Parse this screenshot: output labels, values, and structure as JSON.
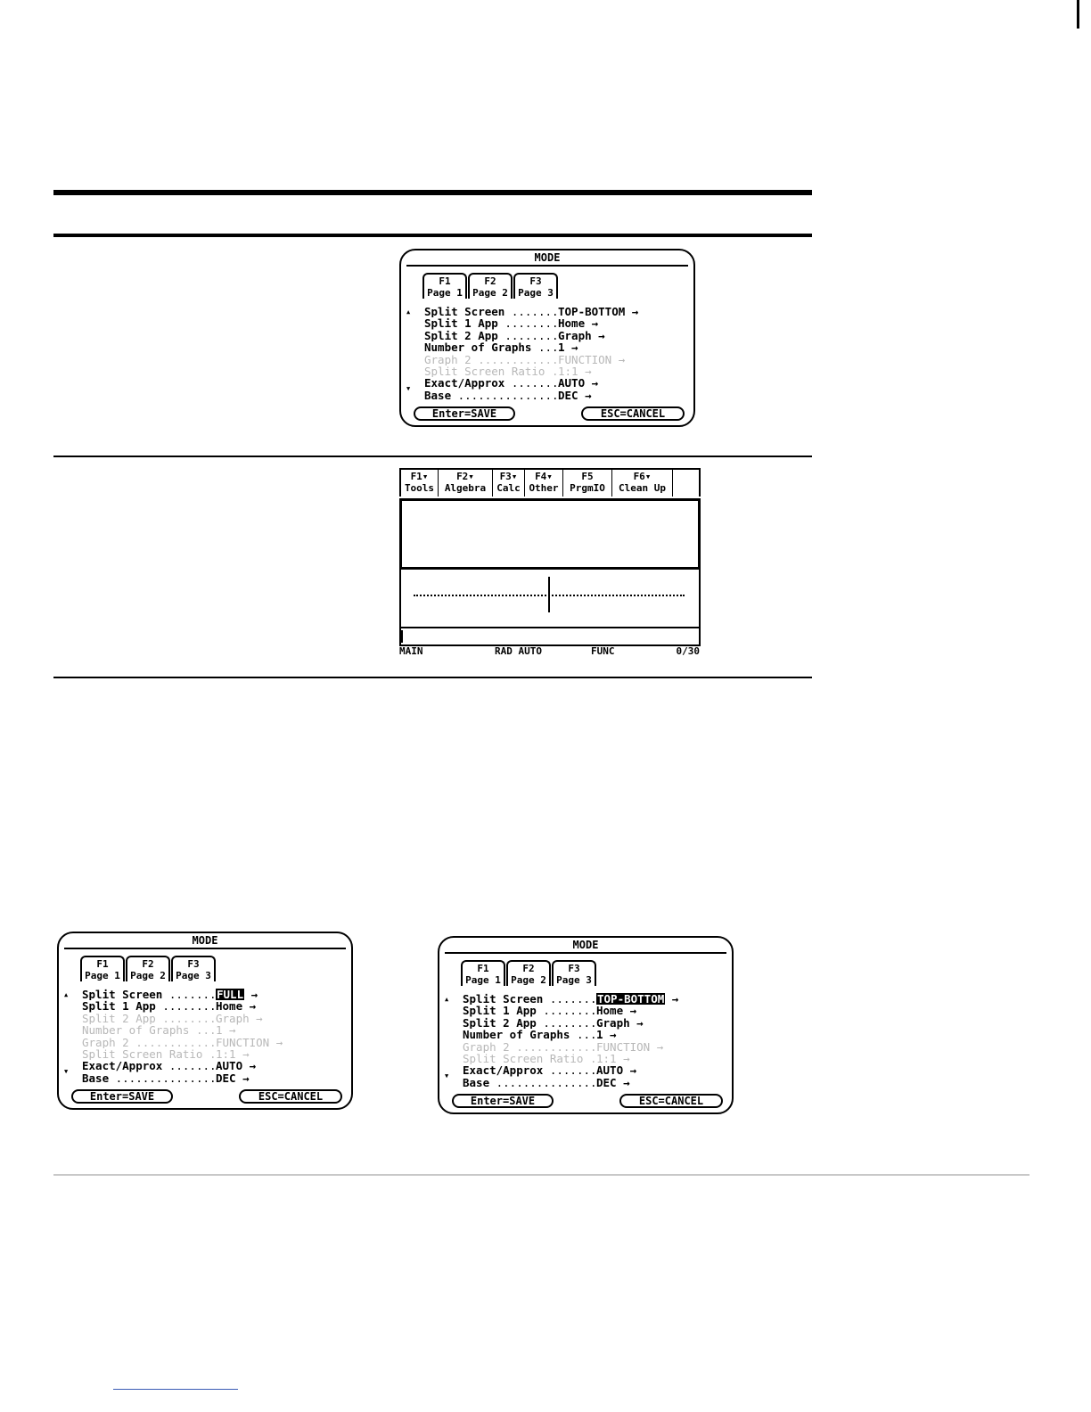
{
  "dialog_top": {
    "title": "MODE",
    "tabs": [
      {
        "key": "F1",
        "label": "Page 1"
      },
      {
        "key": "F2",
        "label": "Page 2"
      },
      {
        "key": "F3",
        "label": "Page 3"
      }
    ],
    "rows": [
      {
        "label": "Split Screen",
        "value": "TOP-BOTTOM →"
      },
      {
        "label": "Split 1 App",
        "value": "Home →"
      },
      {
        "label": "Split 2 App",
        "value": "Graph →"
      },
      {
        "label": "Number of Graphs",
        "value": "1 →"
      },
      {
        "label": "Graph 2",
        "value": "FUNCTION →"
      },
      {
        "label": "Split Screen Ratio",
        "value": "1:1 →"
      },
      {
        "label": "Exact/Approx",
        "value": "AUTO →"
      },
      {
        "label": "Base",
        "value": "DEC →"
      }
    ],
    "save_label": "Enter=SAVE",
    "cancel_label": "ESC=CANCEL"
  },
  "home_screen": {
    "menu": [
      {
        "key": "F1▾",
        "label": "Tools"
      },
      {
        "key": "F2▾",
        "label": "Algebra"
      },
      {
        "key": "F3▾",
        "label": "Calc"
      },
      {
        "key": "F4▾",
        "label": "Other"
      },
      {
        "key": "F5",
        "label": "PrgmIO"
      },
      {
        "key": "F6▾",
        "label": "Clean Up"
      }
    ],
    "status": {
      "folder": "MAIN",
      "mode": "RAD AUTO",
      "graph": "FUNC",
      "history": "0/30"
    }
  },
  "dialog_left": {
    "title": "MODE",
    "tabs": [
      {
        "key": "F1",
        "label": "Page 1"
      },
      {
        "key": "F2",
        "label": "Page 2"
      },
      {
        "key": "F3",
        "label": "Page 3"
      }
    ],
    "rows": [
      {
        "label": "Split Screen",
        "value": "FULL"
      },
      {
        "label": "Split 1 App",
        "value": "Home →"
      },
      {
        "label": "Split 2 App",
        "value": "Graph →"
      },
      {
        "label": "Number of Graphs",
        "value": "1 →"
      },
      {
        "label": "Graph 2",
        "value": "FUNCTION →"
      },
      {
        "label": "Split Screen Ratio",
        "value": "1:1 →"
      },
      {
        "label": "Exact/Approx",
        "value": "AUTO →"
      },
      {
        "label": "Base",
        "value": "DEC →"
      }
    ],
    "save_label": "Enter=SAVE",
    "cancel_label": "ESC=CANCEL"
  },
  "dialog_right": {
    "title": "MODE",
    "tabs": [
      {
        "key": "F1",
        "label": "Page 1"
      },
      {
        "key": "F2",
        "label": "Page 2"
      },
      {
        "key": "F3",
        "label": "Page 3"
      }
    ],
    "rows": [
      {
        "label": "Split Screen",
        "value": "TOP-BOTTOM"
      },
      {
        "label": "Split 1 App",
        "value": "Home →"
      },
      {
        "label": "Split 2 App",
        "value": "Graph →"
      },
      {
        "label": "Number of Graphs",
        "value": "1 →"
      },
      {
        "label": "Graph 2",
        "value": "FUNCTION →"
      },
      {
        "label": "Split Screen Ratio",
        "value": "1:1 →"
      },
      {
        "label": "Exact/Approx",
        "value": "AUTO →"
      },
      {
        "label": "Base",
        "value": "DEC →"
      }
    ],
    "save_label": "Enter=SAVE",
    "cancel_label": "ESC=CANCEL"
  }
}
